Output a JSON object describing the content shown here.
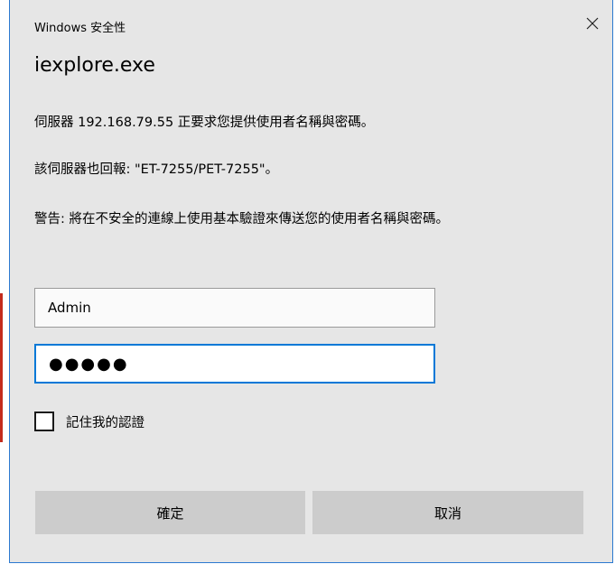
{
  "dialog": {
    "window_title": "Windows 安全性",
    "close_icon": "close-icon",
    "app_name": "iexplore.exe",
    "message_server": "伺服器 192.168.79.55 正要求您提供使用者名稱與密碼。",
    "message_report": "該伺服器也回報: \"ET-7255/PET-7255\"。",
    "message_warning": "警告: 將在不安全的連線上使用基本驗證來傳送您的使用者名稱與密碼。"
  },
  "form": {
    "username_value": "Admin",
    "password_display": "●●●●●",
    "remember_label": "記住我的認證",
    "remember_checked": false
  },
  "buttons": {
    "ok_label": "確定",
    "cancel_label": "取消"
  },
  "colors": {
    "focus_border": "#0078d7",
    "dialog_background": "#e6e6e6",
    "button_background": "#cccccc",
    "window_border": "#2b79d0"
  }
}
